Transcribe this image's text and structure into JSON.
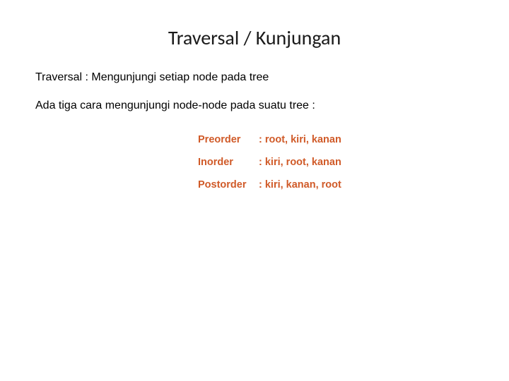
{
  "title": "Traversal / Kunjungan",
  "line1": "Traversal : Mengunjungi setiap node pada tree",
  "line2": "Ada tiga cara mengunjungi node-node pada suatu tree :",
  "orders": [
    {
      "label": "Preorder",
      "value": ": root, kiri, kanan"
    },
    {
      "label": "Inorder",
      "value": ": kiri, root, kanan"
    },
    {
      "label": "Postorder",
      "value": ": kiri, kanan, root"
    }
  ]
}
